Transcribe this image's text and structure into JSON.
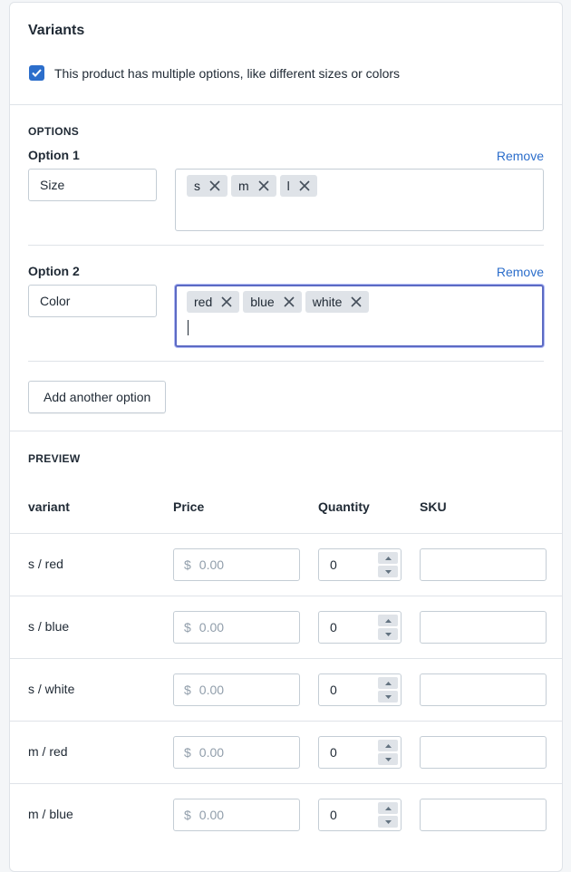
{
  "variants_card": {
    "title": "Variants",
    "multiple_options_checkbox": {
      "label": "This product has multiple options, like different sizes or colors",
      "checked": true
    }
  },
  "options": {
    "heading": "OPTIONS",
    "remove_label": "Remove",
    "add_button": "Add another option",
    "items": [
      {
        "title": "Option 1",
        "name": "Size",
        "values": [
          "s",
          "m",
          "l"
        ]
      },
      {
        "title": "Option 2",
        "name": "Color",
        "values": [
          "red",
          "blue",
          "white"
        ]
      }
    ]
  },
  "preview": {
    "heading": "PREVIEW",
    "columns": [
      "variant",
      "Price",
      "Quantity",
      "SKU"
    ],
    "currency_symbol": "$",
    "price_placeholder": "0.00",
    "rows": [
      {
        "variant": "s / red",
        "quantity": "0",
        "sku": ""
      },
      {
        "variant": "s / blue",
        "quantity": "0",
        "sku": ""
      },
      {
        "variant": "s / white",
        "quantity": "0",
        "sku": ""
      },
      {
        "variant": "m / red",
        "quantity": "0",
        "sku": ""
      },
      {
        "variant": "m / blue",
        "quantity": "0",
        "sku": ""
      }
    ]
  },
  "colors": {
    "accent": "#2c6ecb",
    "focus_border": "#5c6ac4",
    "tag_bg": "#dfe3e8",
    "border": "#c4cdd5"
  }
}
